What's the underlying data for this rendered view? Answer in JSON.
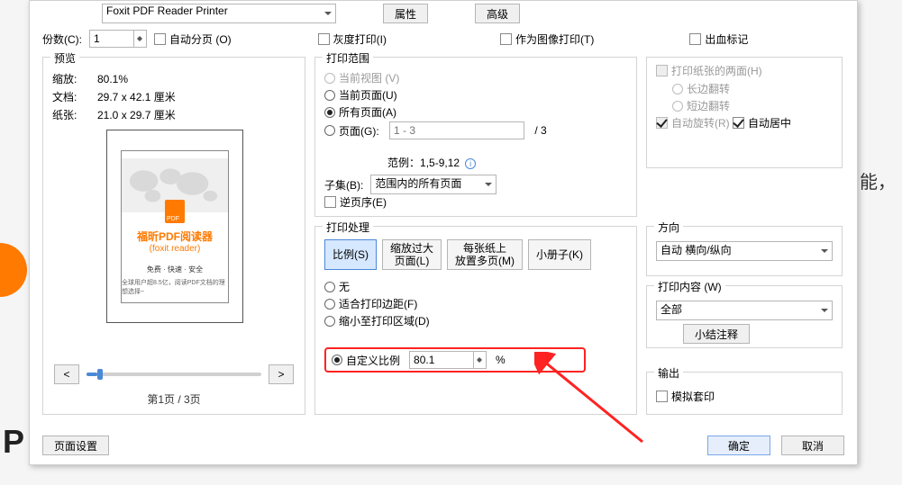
{
  "top": {
    "printer_value": "Foxit PDF Reader Printer",
    "props": "属性",
    "adv": "高级",
    "copies_label": "份数(C):",
    "copies_value": "1",
    "auto_split": "自动分页 (O)",
    "gray": "灰度打印(I)",
    "as_image": "作为图像打印(T)",
    "bleed": "出血标记"
  },
  "preview": {
    "title": "预览",
    "zoom_k": "缩放:",
    "zoom_v": "80.1%",
    "doc_k": "文档:",
    "doc_v": "29.7 x 42.1 厘米",
    "paper_k": "纸张:",
    "paper_v": "21.0 x 29.7 厘米",
    "thumb_title": "福昕PDF阅读器",
    "thumb_sub": "(foxit reader)",
    "thumb_s1": "免费 · 快速 · 安全",
    "thumb_s2": "全球用户超8.5亿，阅读PDF文档的理想选择~",
    "prev": "<",
    "next": ">",
    "page": "第1页 / 3页"
  },
  "range": {
    "title": "打印范围",
    "r1": "当前视图 (V)",
    "r2": "当前页面(U)",
    "r3": "所有页面(A)",
    "r4": "页面(G):",
    "page_hint": "1 - 3",
    "page_total": "/ 3",
    "example_k": "范例：",
    "example_v": "1,5-9,12",
    "subset_k": "子集(B):",
    "subset_v": "范围内的所有页面",
    "reverse": "逆页序(E)"
  },
  "handle": {
    "title": "打印处理",
    "t1": "比例(S)",
    "t2": "缩放过大\n页面(L)",
    "t3": "每张纸上\n放置多页(M)",
    "t4": "小册子(K)",
    "o1": "无",
    "o2": "适合打印边距(F)",
    "o3": "缩小至打印区域(D)",
    "o4": "自定义比例",
    "scale_v": "80.1",
    "pct": "%"
  },
  "duplex": {
    "both": "打印纸张的两面(H)",
    "long": "长边翻转",
    "short": "短边翻转",
    "autorot": "自动旋转(R)",
    "center": "自动居中"
  },
  "orient": {
    "title": "方向",
    "value": "自动 横向/纵向"
  },
  "content": {
    "title": "打印内容 (W)",
    "value": "全部",
    "btn": "小结注释"
  },
  "out": {
    "title": "输出",
    "chk": "模拟套印"
  },
  "footer": {
    "page_setup": "页面设置",
    "ok": "确定",
    "cancel": "取消"
  },
  "bg_text": "能，"
}
